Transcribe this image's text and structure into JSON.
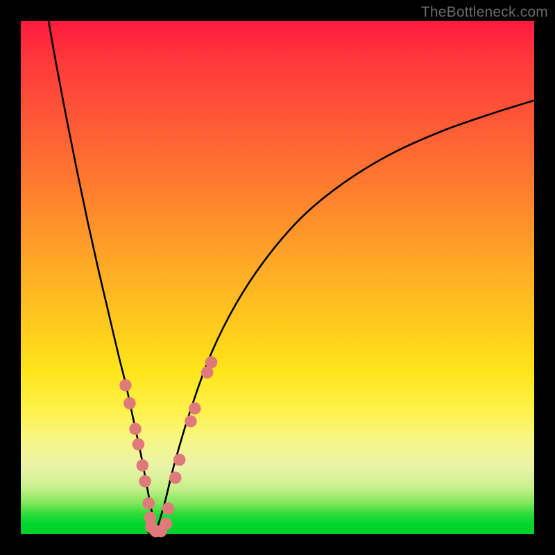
{
  "watermark": "TheBottleneck.com",
  "colors": {
    "frame": "#000000",
    "curve": "#000000",
    "marker_fill": "#e07a7a",
    "marker_stroke": "#d86e6e"
  },
  "chart_data": {
    "type": "line",
    "title": "",
    "xlabel": "",
    "ylabel": "",
    "xlim": [
      0,
      100
    ],
    "ylim": [
      0,
      100
    ],
    "grid": false,
    "legend": false,
    "series": [
      {
        "name": "left-branch",
        "x": [
          5.4,
          7,
          9,
          11,
          13,
          15,
          17,
          19,
          20.5,
          22,
          23.5,
          25,
          26.3
        ],
        "y": [
          100,
          91,
          80.5,
          70.5,
          61,
          52,
          43.5,
          35,
          29,
          22,
          15,
          7,
          0.3
        ]
      },
      {
        "name": "right-branch",
        "x": [
          26.3,
          28,
          30,
          33,
          37,
          42,
          48,
          55,
          63,
          72,
          82,
          92,
          100
        ],
        "y": [
          0.3,
          6,
          14,
          24,
          35,
          45,
          54,
          62,
          68.5,
          74,
          78.5,
          82,
          84.5
        ]
      }
    ],
    "valley_flat": {
      "x_start": 24.8,
      "x_end": 27.8,
      "y": 0.3
    },
    "markers": [
      {
        "x": 20.4,
        "y": 29.0
      },
      {
        "x": 21.2,
        "y": 25.5
      },
      {
        "x": 22.3,
        "y": 20.5
      },
      {
        "x": 22.9,
        "y": 17.5
      },
      {
        "x": 23.7,
        "y": 13.4
      },
      {
        "x": 24.2,
        "y": 10.3
      },
      {
        "x": 24.9,
        "y": 6.0
      },
      {
        "x": 25.2,
        "y": 3.2
      },
      {
        "x": 25.4,
        "y": 1.4
      },
      {
        "x": 26.3,
        "y": 0.6
      },
      {
        "x": 27.3,
        "y": 0.6
      },
      {
        "x": 28.3,
        "y": 2.0
      },
      {
        "x": 28.7,
        "y": 5.0
      },
      {
        "x": 30.1,
        "y": 11.0
      },
      {
        "x": 30.9,
        "y": 14.5
      },
      {
        "x": 33.1,
        "y": 22.0
      },
      {
        "x": 33.9,
        "y": 24.5
      },
      {
        "x": 36.3,
        "y": 31.5
      },
      {
        "x": 37.1,
        "y": 33.5
      }
    ]
  }
}
